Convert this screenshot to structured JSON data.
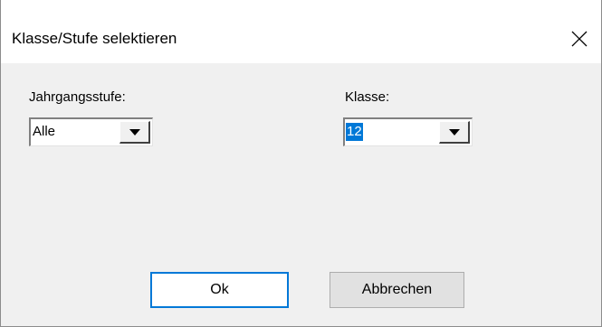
{
  "window": {
    "title": "Klasse/Stufe selektieren"
  },
  "fields": {
    "jahrgangsstufe": {
      "label": "Jahrgangsstufe:",
      "value": "Alle"
    },
    "klasse": {
      "label": "Klasse:",
      "value": "12"
    }
  },
  "buttons": {
    "ok_label": "Ok",
    "cancel_label": "Abbrechen"
  },
  "icons": {
    "close": "close-icon",
    "dropdown": "chevron-down-icon"
  },
  "colors": {
    "selection": "#0078d7",
    "default_button_border": "#0078d7"
  }
}
